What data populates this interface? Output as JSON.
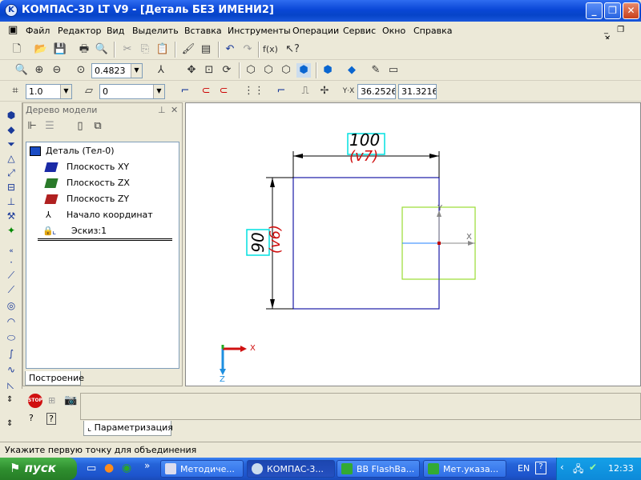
{
  "window": {
    "title": "КОМПАС-3D LT V9 - [Деталь БЕЗ ИМЕНИ2]",
    "icon_name": "kompas-icon"
  },
  "menu": [
    "Файл",
    "Редактор",
    "Вид",
    "Выделить",
    "Вставка",
    "Инструменты",
    "Операции",
    "Сервис",
    "Окно",
    "Справка"
  ],
  "toolbar2": {
    "zoom": "0.4823"
  },
  "toolbar3": {
    "step": "1.0",
    "layer": "0",
    "coord_x": "36.2526",
    "coord_y": "31.3216"
  },
  "tree": {
    "header": "Дерево модели",
    "items": [
      {
        "label": "Деталь (Тел-0)"
      },
      {
        "label": "Плоскость XY"
      },
      {
        "label": "Плоскость ZX"
      },
      {
        "label": "Плоскость ZY"
      },
      {
        "label": "Начало координат"
      },
      {
        "label": "Эскиз:1"
      }
    ],
    "tab": "Построение"
  },
  "canvas": {
    "dim_horizontal_value": "100",
    "dim_horizontal_var": "(v7)",
    "dim_vertical_value": "90",
    "dim_vertical_var": "(v6)",
    "axis_y_label": "Y",
    "axis_x_label": "X",
    "triad_x_label": "X",
    "triad_z_label": "Z"
  },
  "bottom": {
    "tab": "Параметризация"
  },
  "status": {
    "text": "Укажите первую точку для объединения"
  },
  "taskbar": {
    "start": "пуск",
    "tasks": [
      "Методиче...",
      "КОМПАС-3...",
      "BB FlashBa...",
      "Мет.указа..."
    ],
    "lang": "EN",
    "time": "12:33"
  },
  "colors": {
    "title_blue": "#0a47d6",
    "sketch_blue": "#1a1aa6",
    "dim_black": "#000000",
    "var_red": "#d01010",
    "highlight_cyan": "#00ffff",
    "green_box": "#99dd33"
  }
}
